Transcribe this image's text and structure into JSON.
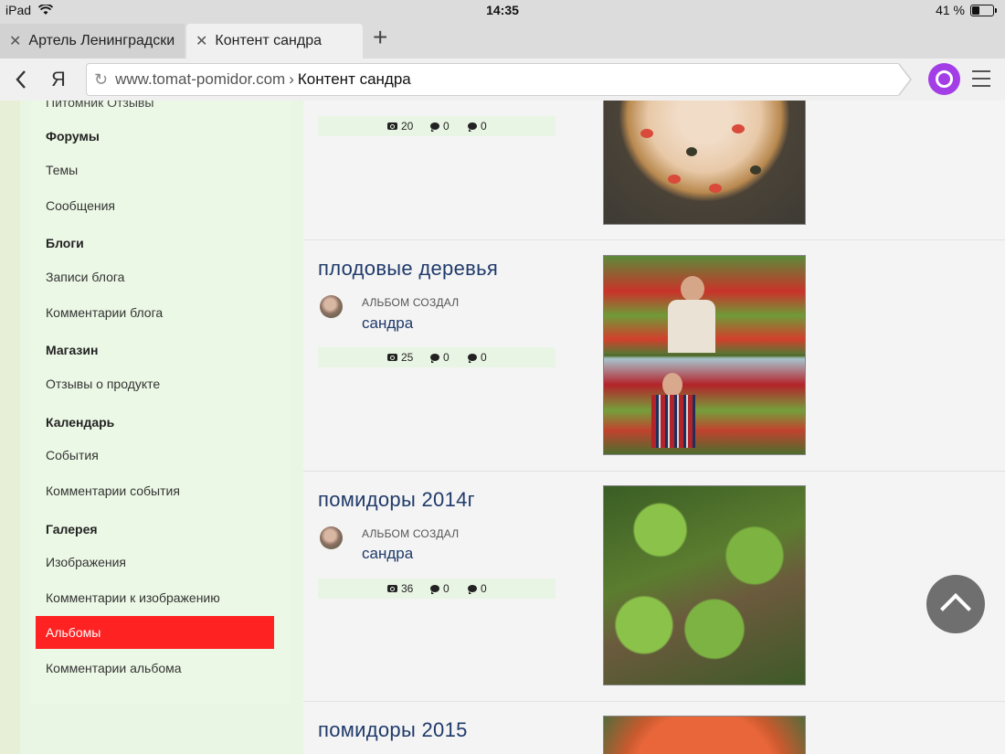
{
  "status_bar": {
    "device": "iPad",
    "time": "14:35",
    "battery_pct": "41 %",
    "battery_fraction": 0.41
  },
  "browser": {
    "tabs": [
      {
        "label": "Артель Ленинградски",
        "active": false
      },
      {
        "label": "Контент сандра",
        "active": true
      }
    ],
    "url_domain": "www.tomat-pomidor.com",
    "url_separator": "›",
    "url_page": "Контент сандра",
    "yandex_logo": "Я"
  },
  "sidebar": {
    "cut_item": "Питомник Отзывы",
    "sections": [
      {
        "heading": "Форумы",
        "items": [
          "Темы",
          "Сообщения"
        ]
      },
      {
        "heading": "Блоги",
        "items": [
          "Записи блога",
          "Комментарии блога"
        ]
      },
      {
        "heading": "Магазин",
        "items": [
          "Отзывы о продукте"
        ]
      },
      {
        "heading": "Календарь",
        "items": [
          "События",
          "Комментарии события"
        ]
      },
      {
        "heading": "Галерея",
        "items": [
          "Изображения",
          "Комментарии к изображению",
          "Альбомы",
          "Комментарии альбома"
        ]
      }
    ],
    "active_item": "Альбомы"
  },
  "albums": [
    {
      "title": "",
      "photos": "20",
      "comments": "0",
      "likes": "0"
    },
    {
      "title": "плодовые деревья",
      "created_label": "АЛЬБОМ СОЗДАЛ",
      "author": "сандра",
      "photos": "25",
      "comments": "0",
      "likes": "0"
    },
    {
      "title": "помидоры 2014г",
      "created_label": "АЛЬБОМ СОЗДАЛ",
      "author": "сандра",
      "photos": "36",
      "comments": "0",
      "likes": "0"
    },
    {
      "title": "помидоры 2015"
    }
  ],
  "colors": {
    "active_item_bg": "#ff2222",
    "title_blue": "#1f3a6a",
    "alice_purple": "#a33ee6"
  }
}
